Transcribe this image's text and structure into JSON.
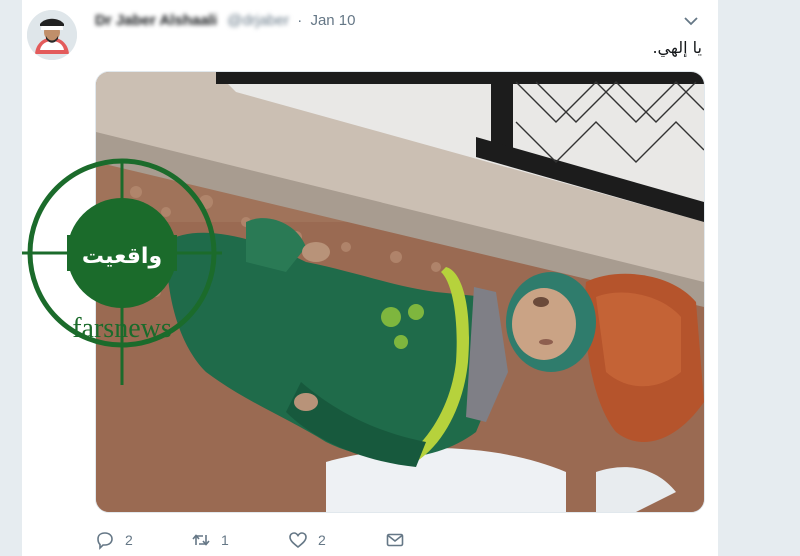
{
  "tweet": {
    "author_name": "Dr Jaber Alshaali",
    "author_handle": "@drjaber",
    "separator": "·",
    "date": "Jan 10",
    "text": "يا إلهي."
  },
  "media": {
    "watermark": {
      "brand": "farsnews",
      "arabic": "واقعيت"
    }
  },
  "actions": {
    "reply_count": "2",
    "retweet_count": "1",
    "like_count": "2"
  },
  "icons": [
    "chevron-down-icon",
    "reply-icon",
    "retweet-icon",
    "like-icon",
    "message-icon"
  ],
  "colors": {
    "gutter": "#e6ecf0",
    "muted_text": "#657786",
    "watermark_green": "#1b6b2b"
  }
}
